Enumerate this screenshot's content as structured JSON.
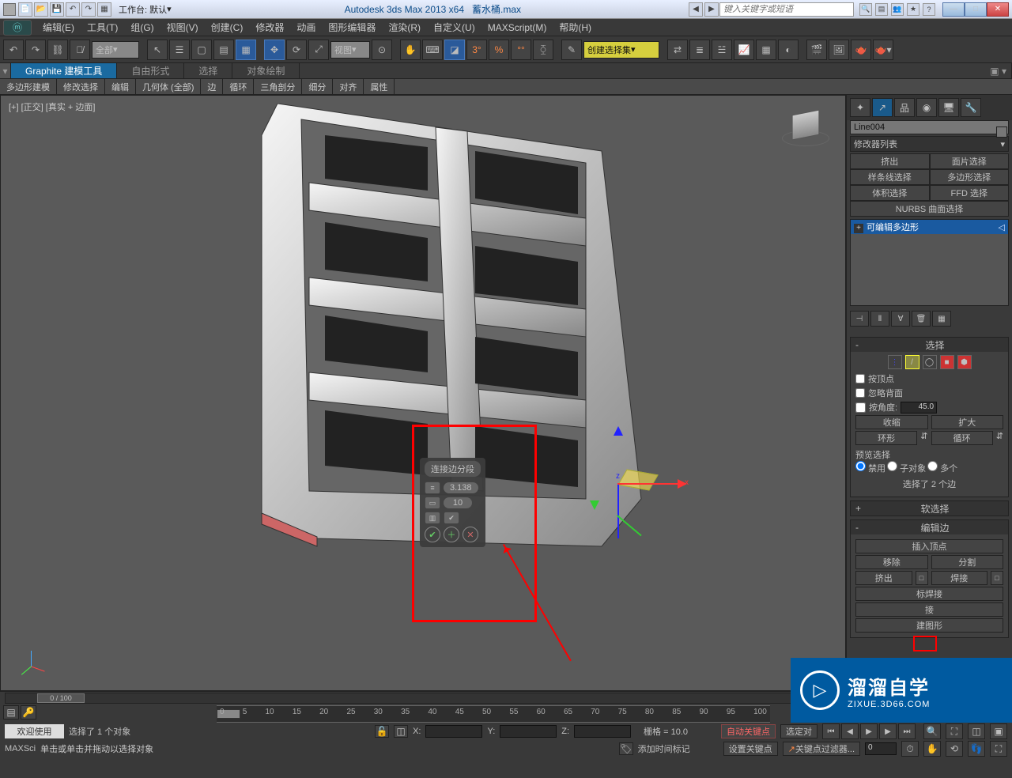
{
  "titlebar": {
    "workspace": "工作台: 默认",
    "app": "Autodesk 3ds Max  2013 x64",
    "file": "蓄水桶.max",
    "search_placeholder": "键入关键字或短语"
  },
  "menu": [
    "编辑(E)",
    "工具(T)",
    "组(G)",
    "视图(V)",
    "创建(C)",
    "修改器",
    "动画",
    "图形编辑器",
    "渲染(R)",
    "自定义(U)",
    "MAXScript(M)",
    "帮助(H)"
  ],
  "toolbar": {
    "sel_filter": "全部",
    "view_dd": "视图",
    "named_sel": "创建选择集"
  },
  "ribbon": {
    "tabs": [
      "Graphite 建模工具",
      "自由形式",
      "选择",
      "对象绘制"
    ],
    "subtabs": [
      "多边形建模",
      "修改选择",
      "编辑",
      "几何体 (全部)",
      "边",
      "循环",
      "三角剖分",
      "细分",
      "对齐",
      "属性"
    ]
  },
  "viewport": {
    "label": "[+] [正交] [真实 + 边面]"
  },
  "caddy": {
    "title": "连接边分段",
    "val1": "3.138",
    "val2": "10"
  },
  "panel": {
    "obj_name": "Line004",
    "mod_list_label": "修改器列表",
    "btns_row1": [
      "挤出",
      "面片选择"
    ],
    "btns_row2": [
      "样条线选择",
      "多边形选择"
    ],
    "btns_row3": [
      "体积选择",
      "FFD 选择"
    ],
    "nurbs": "NURBS 曲面选择",
    "stack_item": "可编辑多边形",
    "rollouts": {
      "selection": {
        "title": "选择",
        "by_vertex": "按顶点",
        "ignore_back": "忽略背面",
        "by_angle": "按角度:",
        "by_angle_val": "45.0",
        "shrink": "收缩",
        "grow": "扩大",
        "ring": "环形",
        "loop": "循环",
        "preview": "预览选择",
        "radios": [
          "禁用",
          "子对象",
          "多个"
        ],
        "sel_info": "选择了 2 个边"
      },
      "soft": {
        "title": "软选择",
        "pm": "+"
      },
      "editedge": {
        "title": "编辑边",
        "pm": "-",
        "insert_vertex": "插入顶点",
        "remove": "移除",
        "split": "分割",
        "extrude": "挤出",
        "weld": "焊接",
        "target_weld": "标焊接",
        "connect_dialog": "接",
        "insert_bridge": "建图形"
      }
    }
  },
  "timeline": {
    "scrub": "0 / 100",
    "ticks": [
      "0",
      "5",
      "10",
      "15",
      "20",
      "25",
      "30",
      "35",
      "40",
      "45",
      "50",
      "55",
      "60",
      "65",
      "70",
      "75",
      "80",
      "85",
      "90",
      "95",
      "100"
    ]
  },
  "status": {
    "welcome1": "欢迎使用",
    "welcome2": "MAXSci",
    "sel": "选择了 1 个对象",
    "hint": "单击或单击并拖动以选择对象",
    "grid": "栅格 = 10.0",
    "autokey": "自动关键点",
    "selset": "选定对",
    "setkey": "设置关键点",
    "keyfilter": "关键点过滤器...",
    "x_lbl": "X:",
    "y_lbl": "Y:",
    "z_lbl": "Z:",
    "framecur": "0",
    "addmarker": "添加时间标记"
  },
  "watermark": {
    "cn": "溜溜自学",
    "en": "ZIXUE.3D66.COM"
  }
}
